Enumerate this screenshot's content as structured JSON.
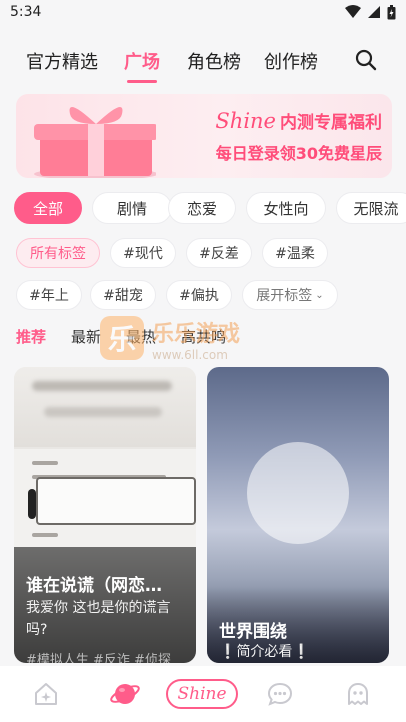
{
  "status": {
    "time": "5:34"
  },
  "nav": {
    "tabs": [
      {
        "label": "官方精选"
      },
      {
        "label": "广场"
      },
      {
        "label": "角色榜"
      },
      {
        "label": "创作榜"
      }
    ],
    "active_index": 1
  },
  "banner": {
    "logo": "Shine",
    "title": "内测专属福利",
    "subtitle": "每日登录领30免费星辰"
  },
  "categories": [
    {
      "label": "全部"
    },
    {
      "label": "剧情"
    },
    {
      "label": "恋爱"
    },
    {
      "label": "女性向"
    },
    {
      "label": "无限流"
    }
  ],
  "tags": [
    {
      "label": "所有标签"
    },
    {
      "label": "#现代"
    },
    {
      "label": "#反差"
    },
    {
      "label": "#温柔"
    },
    {
      "label": "#年上"
    },
    {
      "label": "#甜宠"
    },
    {
      "label": "#偏执"
    },
    {
      "label": "展开标签"
    }
  ],
  "sort": [
    {
      "label": "推荐"
    },
    {
      "label": "最新"
    },
    {
      "label": "最热"
    },
    {
      "label": "高共鸣"
    }
  ],
  "watermark": {
    "logo": "乐",
    "text": "乐乐游戏",
    "url": "www.6ll.com"
  },
  "cards": [
    {
      "title": "谁在说谎（网恋…",
      "desc": "我爱你 这也是你的谎言吗?",
      "tags": "#模拟人生 #反诈 #侦探"
    },
    {
      "title": "世界围绕",
      "desc": "简介必看",
      "exclam": "❕"
    }
  ],
  "bottom_nav": {
    "shine_label": "Shine"
  },
  "colors": {
    "accent": "#ff5c8a",
    "accent_light": "#fdecf0"
  }
}
